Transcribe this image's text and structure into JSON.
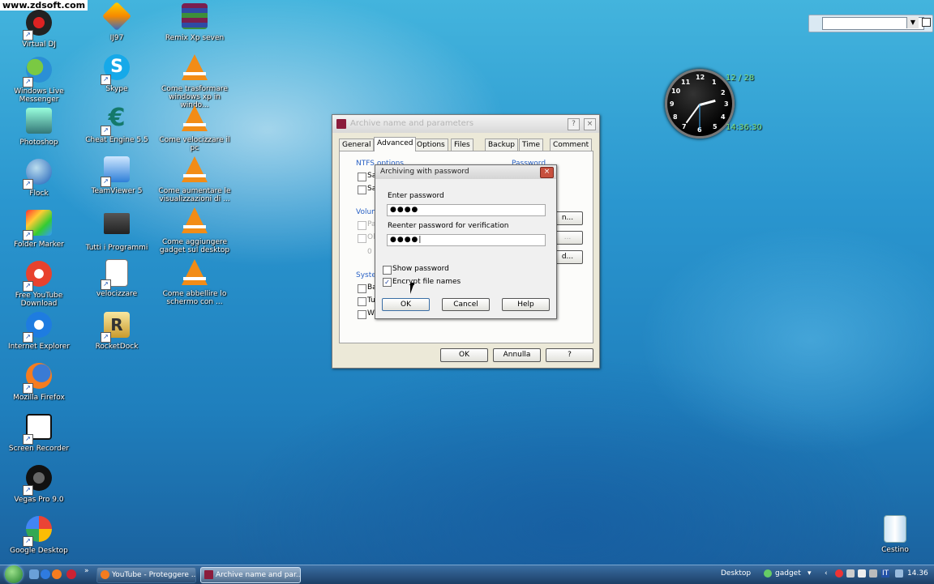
{
  "watermark": "www.zdsoft.com",
  "desktop_icons": [
    {
      "label": "Virtual DJ"
    },
    {
      "label": "Windows Live Messenger"
    },
    {
      "label": "Photoshop"
    },
    {
      "label": "Flock"
    },
    {
      "label": "Folder Marker"
    },
    {
      "label": "Free YouTube Download"
    },
    {
      "label": "Internet Explorer"
    },
    {
      "label": "Mozilla Firefox"
    },
    {
      "label": "Screen Recorder"
    },
    {
      "label": "Vegas Pro 9.0"
    },
    {
      "label": "Google Desktop"
    },
    {
      "label": "IJ97"
    },
    {
      "label": "Skype"
    },
    {
      "label": "Cheat Engine 5.5"
    },
    {
      "label": "TeamViewer 5"
    },
    {
      "label": "Tutti i Programmi"
    },
    {
      "label": "velocizzare"
    },
    {
      "label": "RocketDock"
    },
    {
      "label": "Remix Xp seven"
    },
    {
      "label": "Come trasformare windows xp in windo..."
    },
    {
      "label": "Come velocizzare il pc"
    },
    {
      "label": "Come aumentare le visualizzazioni di ..."
    },
    {
      "label": "Come aggiungere gadget sul desktop"
    },
    {
      "label": "Come abbellire lo schermo con ..."
    },
    {
      "label": "Cestino"
    }
  ],
  "clock": {
    "date": "12 / 28",
    "time": "14:36:30",
    "numbers": [
      "12",
      "1",
      "2",
      "3",
      "4",
      "5",
      "6",
      "7",
      "8",
      "9",
      "10",
      "11"
    ]
  },
  "archive_window": {
    "title": "Archive name and parameters",
    "help": "?",
    "close": "×",
    "tabs": [
      "General",
      "Advanced",
      "Options",
      "Files",
      "Backup",
      "Time",
      "Comment"
    ],
    "active_tab": "Advanced",
    "groups": {
      "ntfs": "NTFS options",
      "volumes": "Volumes",
      "system": "System",
      "password": "Password..."
    },
    "partial_labels": [
      "Sa",
      "Sa",
      "Pa",
      "Ol",
      "0",
      "Ba",
      "Tu",
      "W"
    ],
    "buttons": {
      "ok": "OK",
      "cancel": "Annulla",
      "help": "?"
    }
  },
  "password_dialog": {
    "title": "Archiving with password",
    "close": "×",
    "enter_label": "Enter password",
    "enter_value": "●●●●",
    "reenter_label": "Reenter password for verification",
    "reenter_value": "●●●●|",
    "show_password": {
      "label": "Show password",
      "checked": false
    },
    "encrypt_names": {
      "label": "Encrypt file names",
      "checked": true,
      "mark": "✓"
    },
    "buttons": {
      "ok": "OK",
      "cancel": "Cancel",
      "help": "Help"
    }
  },
  "taskbar": {
    "tasks": [
      {
        "label": "YouTube - Proteggere ..."
      },
      {
        "label": "Archive name and par..."
      }
    ],
    "desktop_label": "Desktop",
    "gadget_label": "gadget",
    "lang": "IT",
    "time": "14.36"
  }
}
